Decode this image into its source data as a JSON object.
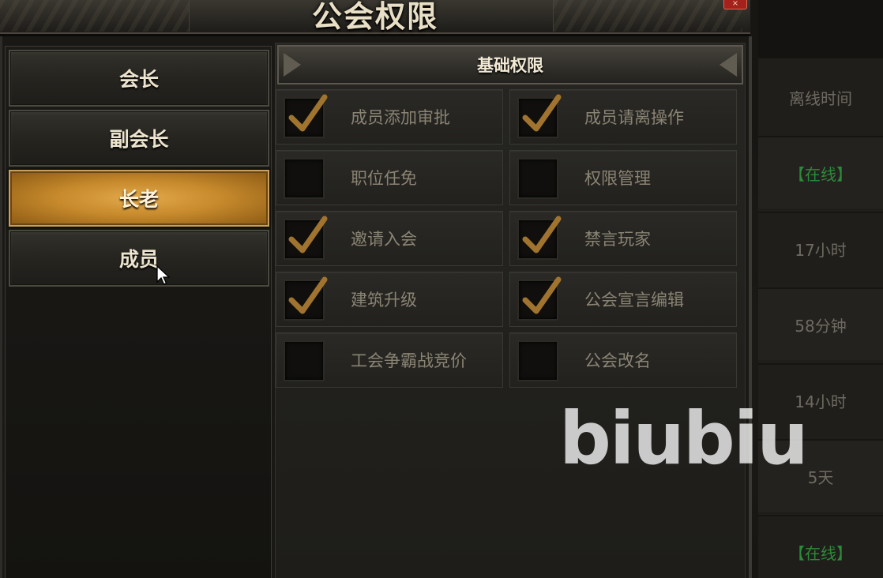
{
  "window": {
    "title": "公会权限",
    "close_label": "×"
  },
  "ranks": [
    {
      "label": "会长",
      "selected": false
    },
    {
      "label": "副会长",
      "selected": false
    },
    {
      "label": "长老",
      "selected": true
    },
    {
      "label": "成员",
      "selected": false
    }
  ],
  "permissions": {
    "header": "基础权限",
    "items": [
      {
        "label": "成员添加审批",
        "checked": true
      },
      {
        "label": "成员请离操作",
        "checked": true
      },
      {
        "label": "职位任免",
        "checked": false
      },
      {
        "label": "权限管理",
        "checked": false
      },
      {
        "label": "邀请入会",
        "checked": true
      },
      {
        "label": "禁言玩家",
        "checked": true
      },
      {
        "label": "建筑升级",
        "checked": true
      },
      {
        "label": "公会宣言编辑",
        "checked": true
      },
      {
        "label": "工会争霸战竞价",
        "checked": false
      },
      {
        "label": "公会改名",
        "checked": false
      }
    ]
  },
  "member_list": {
    "column_header": "离线时间",
    "rows": [
      "【在线】",
      "17小时",
      "58分钟",
      "14小时",
      "5天",
      "【在线】"
    ]
  },
  "watermark": "biubiu",
  "colors": {
    "selected_rank": "#c78a2c",
    "checkmark": "#a0742f",
    "online_text": "#2c8a3a"
  }
}
